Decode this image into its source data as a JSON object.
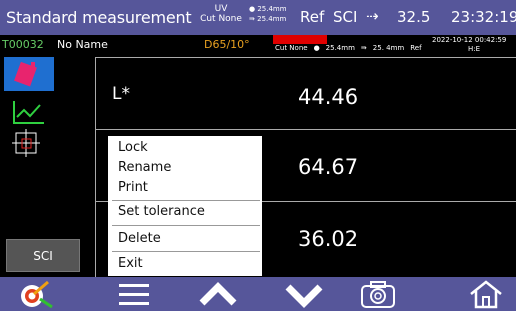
{
  "status": {
    "title": "Standard measurement",
    "uv_line1": "UV",
    "uv_line2": "Cut None",
    "lens_line1": "25.4mm",
    "lens_line2": "25.4mm",
    "ref": "Ref",
    "mode": "SCI",
    "temperature": "32.5",
    "time": "23:32:19"
  },
  "info": {
    "sample_id": "T00032",
    "sample_name": "No Name",
    "illuminant": "D65/10°",
    "cut": "Cut None",
    "aperture1": "25.4mm",
    "aperture2": "25. 4mm",
    "ref": "Ref",
    "datetime": "2022-10-12  00:42:59",
    "he": "H:E"
  },
  "readings": {
    "label": "L*",
    "value1": "44.46",
    "value2": "64.67",
    "value3": "36.02"
  },
  "menu": {
    "items": [
      "Lock",
      "Rename",
      "Print",
      "Set tolerance",
      "Delete",
      "Exit"
    ]
  },
  "side": {
    "sci_button": "SCI"
  },
  "colors": {
    "bar": "#56569a",
    "accent": "#1f6fd0",
    "alert": "#e00000"
  }
}
